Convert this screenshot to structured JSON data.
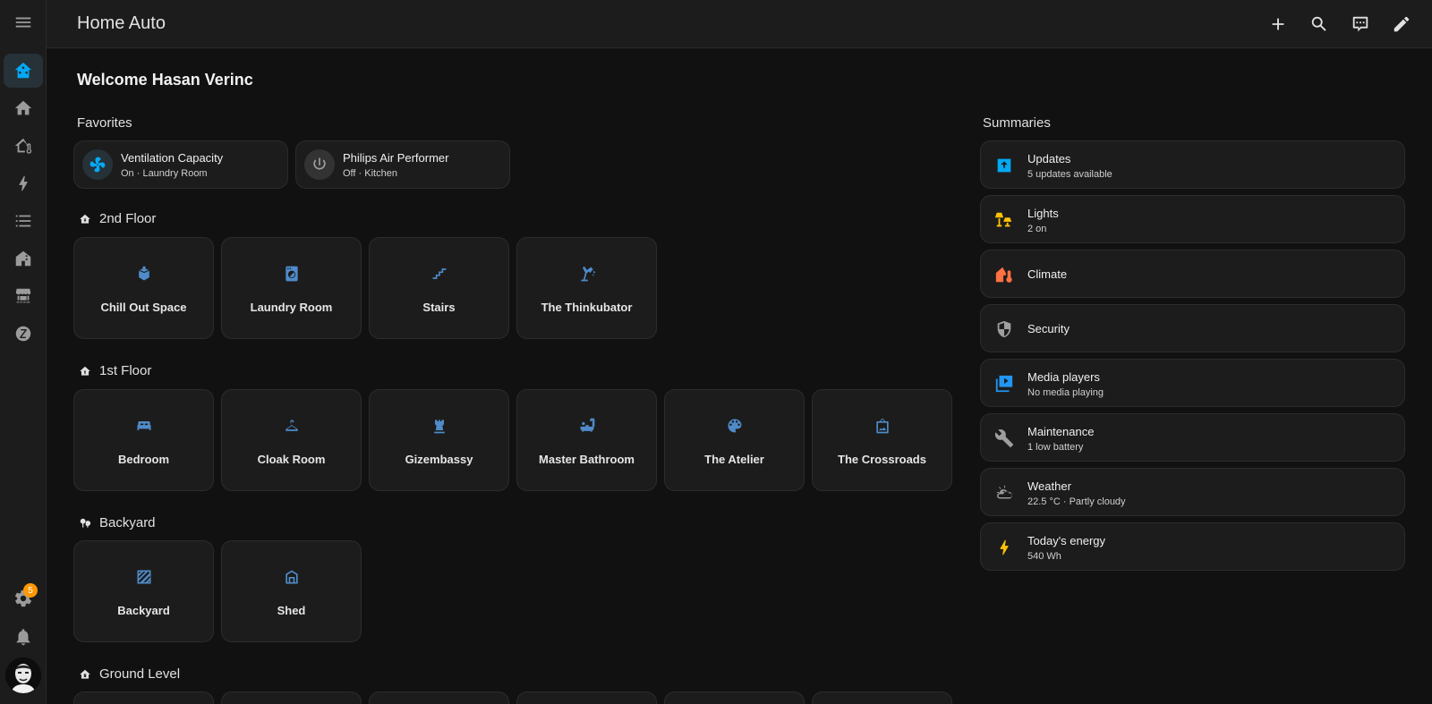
{
  "header": {
    "title": "Home Auto"
  },
  "sidebar": {
    "badge_count": "5"
  },
  "welcome": "Welcome Hasan Verinc",
  "favorites": {
    "title": "Favorites",
    "items": [
      {
        "name": "Ventilation Capacity",
        "state": "On · Laundry Room"
      },
      {
        "name": "Philips Air Performer",
        "state": "Off · Kitchen"
      }
    ]
  },
  "floors": [
    {
      "name": "2nd Floor",
      "areas": [
        "Chill Out Space",
        "Laundry Room",
        "Stairs",
        "The Thinkubator"
      ]
    },
    {
      "name": "1st Floor",
      "areas": [
        "Bedroom",
        "Cloak Room",
        "Gizembassy",
        "Master Bathroom",
        "The Atelier",
        "The Crossroads"
      ]
    },
    {
      "name": "Backyard",
      "areas": [
        "Backyard",
        "Shed"
      ]
    },
    {
      "name": "Ground Level",
      "areas": []
    }
  ],
  "summaries": {
    "title": "Summaries",
    "items": [
      {
        "name": "Updates",
        "state": "5 updates available",
        "color": "#03a9f4"
      },
      {
        "name": "Lights",
        "state": "2 on",
        "color": "#ffc107"
      },
      {
        "name": "Climate",
        "state": "",
        "color": "#ff7043"
      },
      {
        "name": "Security",
        "state": "",
        "color": "#9e9e9e"
      },
      {
        "name": "Media players",
        "state": "No media playing",
        "color": "#2196f3"
      },
      {
        "name": "Maintenance",
        "state": "1 low battery",
        "color": "#9e9e9e"
      },
      {
        "name": "Weather",
        "state": "22.5 °C · Partly cloudy",
        "color": "#9e9e9e"
      },
      {
        "name": "Today's energy",
        "state": "540 Wh",
        "color": "#ffc107"
      }
    ]
  },
  "colors": {
    "accent": "#03a9f4",
    "area_icon": "#4f8bc9",
    "badge": "#ff9800"
  }
}
